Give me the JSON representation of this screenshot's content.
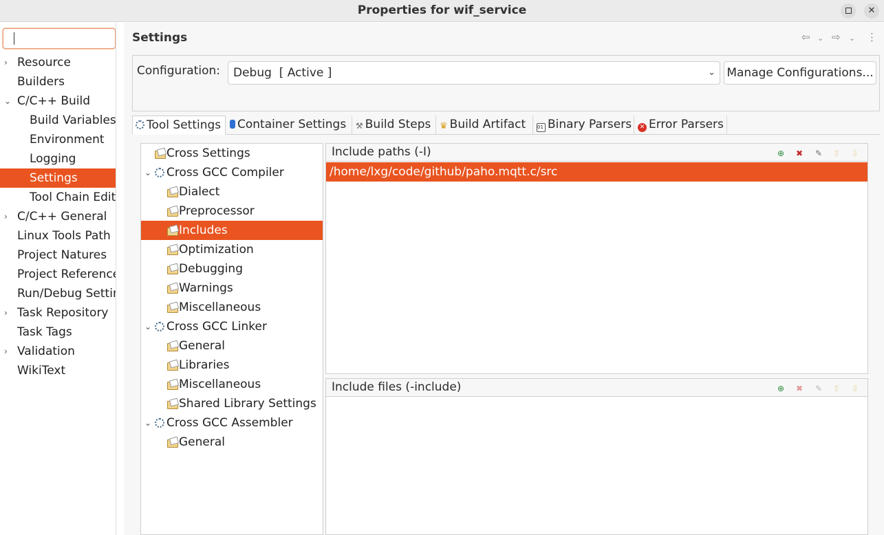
{
  "window": {
    "title": "Properties for wif_service"
  },
  "filter": {
    "placeholder": ""
  },
  "sidebar": {
    "items": [
      {
        "label": "Resource",
        "expandable": true,
        "indent": 0
      },
      {
        "label": "Builders",
        "expandable": false,
        "indent": 0
      },
      {
        "label": "C/C++ Build",
        "expandable": true,
        "expanded": true,
        "indent": 0
      },
      {
        "label": "Build Variables",
        "expandable": false,
        "indent": 1
      },
      {
        "label": "Environment",
        "expandable": false,
        "indent": 1
      },
      {
        "label": "Logging",
        "expandable": false,
        "indent": 1
      },
      {
        "label": "Settings",
        "expandable": false,
        "indent": 1,
        "selected": true
      },
      {
        "label": "Tool Chain Edito",
        "expandable": false,
        "indent": 1
      },
      {
        "label": "C/C++ General",
        "expandable": true,
        "indent": 0
      },
      {
        "label": "Linux Tools Path",
        "expandable": false,
        "indent": 0
      },
      {
        "label": "Project Natures",
        "expandable": false,
        "indent": 0
      },
      {
        "label": "Project Reference",
        "expandable": false,
        "indent": 0
      },
      {
        "label": "Run/Debug Settin",
        "expandable": false,
        "indent": 0
      },
      {
        "label": "Task Repository",
        "expandable": true,
        "indent": 0
      },
      {
        "label": "Task Tags",
        "expandable": false,
        "indent": 0
      },
      {
        "label": "Validation",
        "expandable": true,
        "indent": 0
      },
      {
        "label": "WikiText",
        "expandable": false,
        "indent": 0
      }
    ]
  },
  "main": {
    "title": "Settings",
    "config_label": "Configuration:",
    "config_value": "Debug  [ Active ]",
    "manage_button": "Manage Configurations...",
    "tabs": [
      {
        "label": "Tool Settings",
        "active": true,
        "icon": "tool-settings-icon"
      },
      {
        "label": "Container Settings",
        "icon": "container-icon"
      },
      {
        "label": "Build Steps",
        "icon": "build-steps-icon"
      },
      {
        "label": "Build Artifact",
        "icon": "trophy-icon"
      },
      {
        "label": "Binary Parsers",
        "icon": "binary-icon"
      },
      {
        "label": "Error Parsers",
        "icon": "error-icon"
      }
    ]
  },
  "tree": {
    "items": [
      {
        "label": "Cross Settings",
        "type": "folder",
        "level": 0
      },
      {
        "label": "Cross GCC Compiler",
        "type": "tool",
        "level": 0,
        "expanded": true
      },
      {
        "label": "Dialect",
        "type": "folder",
        "level": 1
      },
      {
        "label": "Preprocessor",
        "type": "folder",
        "level": 1
      },
      {
        "label": "Includes",
        "type": "folder",
        "level": 1,
        "selected": true
      },
      {
        "label": "Optimization",
        "type": "folder",
        "level": 1
      },
      {
        "label": "Debugging",
        "type": "folder",
        "level": 1
      },
      {
        "label": "Warnings",
        "type": "folder",
        "level": 1
      },
      {
        "label": "Miscellaneous",
        "type": "folder",
        "level": 1
      },
      {
        "label": "Cross GCC Linker",
        "type": "tool",
        "level": 0,
        "expanded": true
      },
      {
        "label": "General",
        "type": "folder",
        "level": 1
      },
      {
        "label": "Libraries",
        "type": "folder",
        "level": 1
      },
      {
        "label": "Miscellaneous",
        "type": "folder",
        "level": 1
      },
      {
        "label": "Shared Library Settings",
        "type": "folder",
        "level": 1
      },
      {
        "label": "Cross GCC Assembler",
        "type": "tool",
        "level": 0,
        "expanded": true
      },
      {
        "label": "General",
        "type": "folder",
        "level": 1
      }
    ]
  },
  "include_paths": {
    "title": "Include paths (-I)",
    "items": [
      "/home/lxg/code/github/paho.mqtt.c/src"
    ]
  },
  "include_files": {
    "title": "Include files (-include)",
    "items": []
  },
  "colors": {
    "accent": "#e95420",
    "titlebar": "#ebebeb",
    "panel_bg": "#f7f7f7"
  }
}
